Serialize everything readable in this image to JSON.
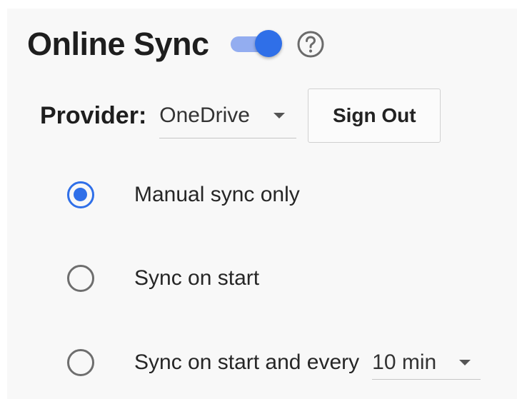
{
  "header": {
    "title": "Online Sync",
    "sync_enabled": true,
    "help_icon": "help-circle-icon"
  },
  "provider": {
    "label": "Provider:",
    "selected": "OneDrive",
    "sign_out_label": "Sign Out"
  },
  "options": [
    {
      "label": "Manual sync only",
      "checked": true
    },
    {
      "label": "Sync on start",
      "checked": false
    },
    {
      "label": "Sync on start and every",
      "checked": false,
      "interval": "10 min"
    }
  ],
  "colors": {
    "accent": "#2f6fe8",
    "toggle_track": "#93adf0",
    "radio_unchecked": "#6e6e6e"
  }
}
